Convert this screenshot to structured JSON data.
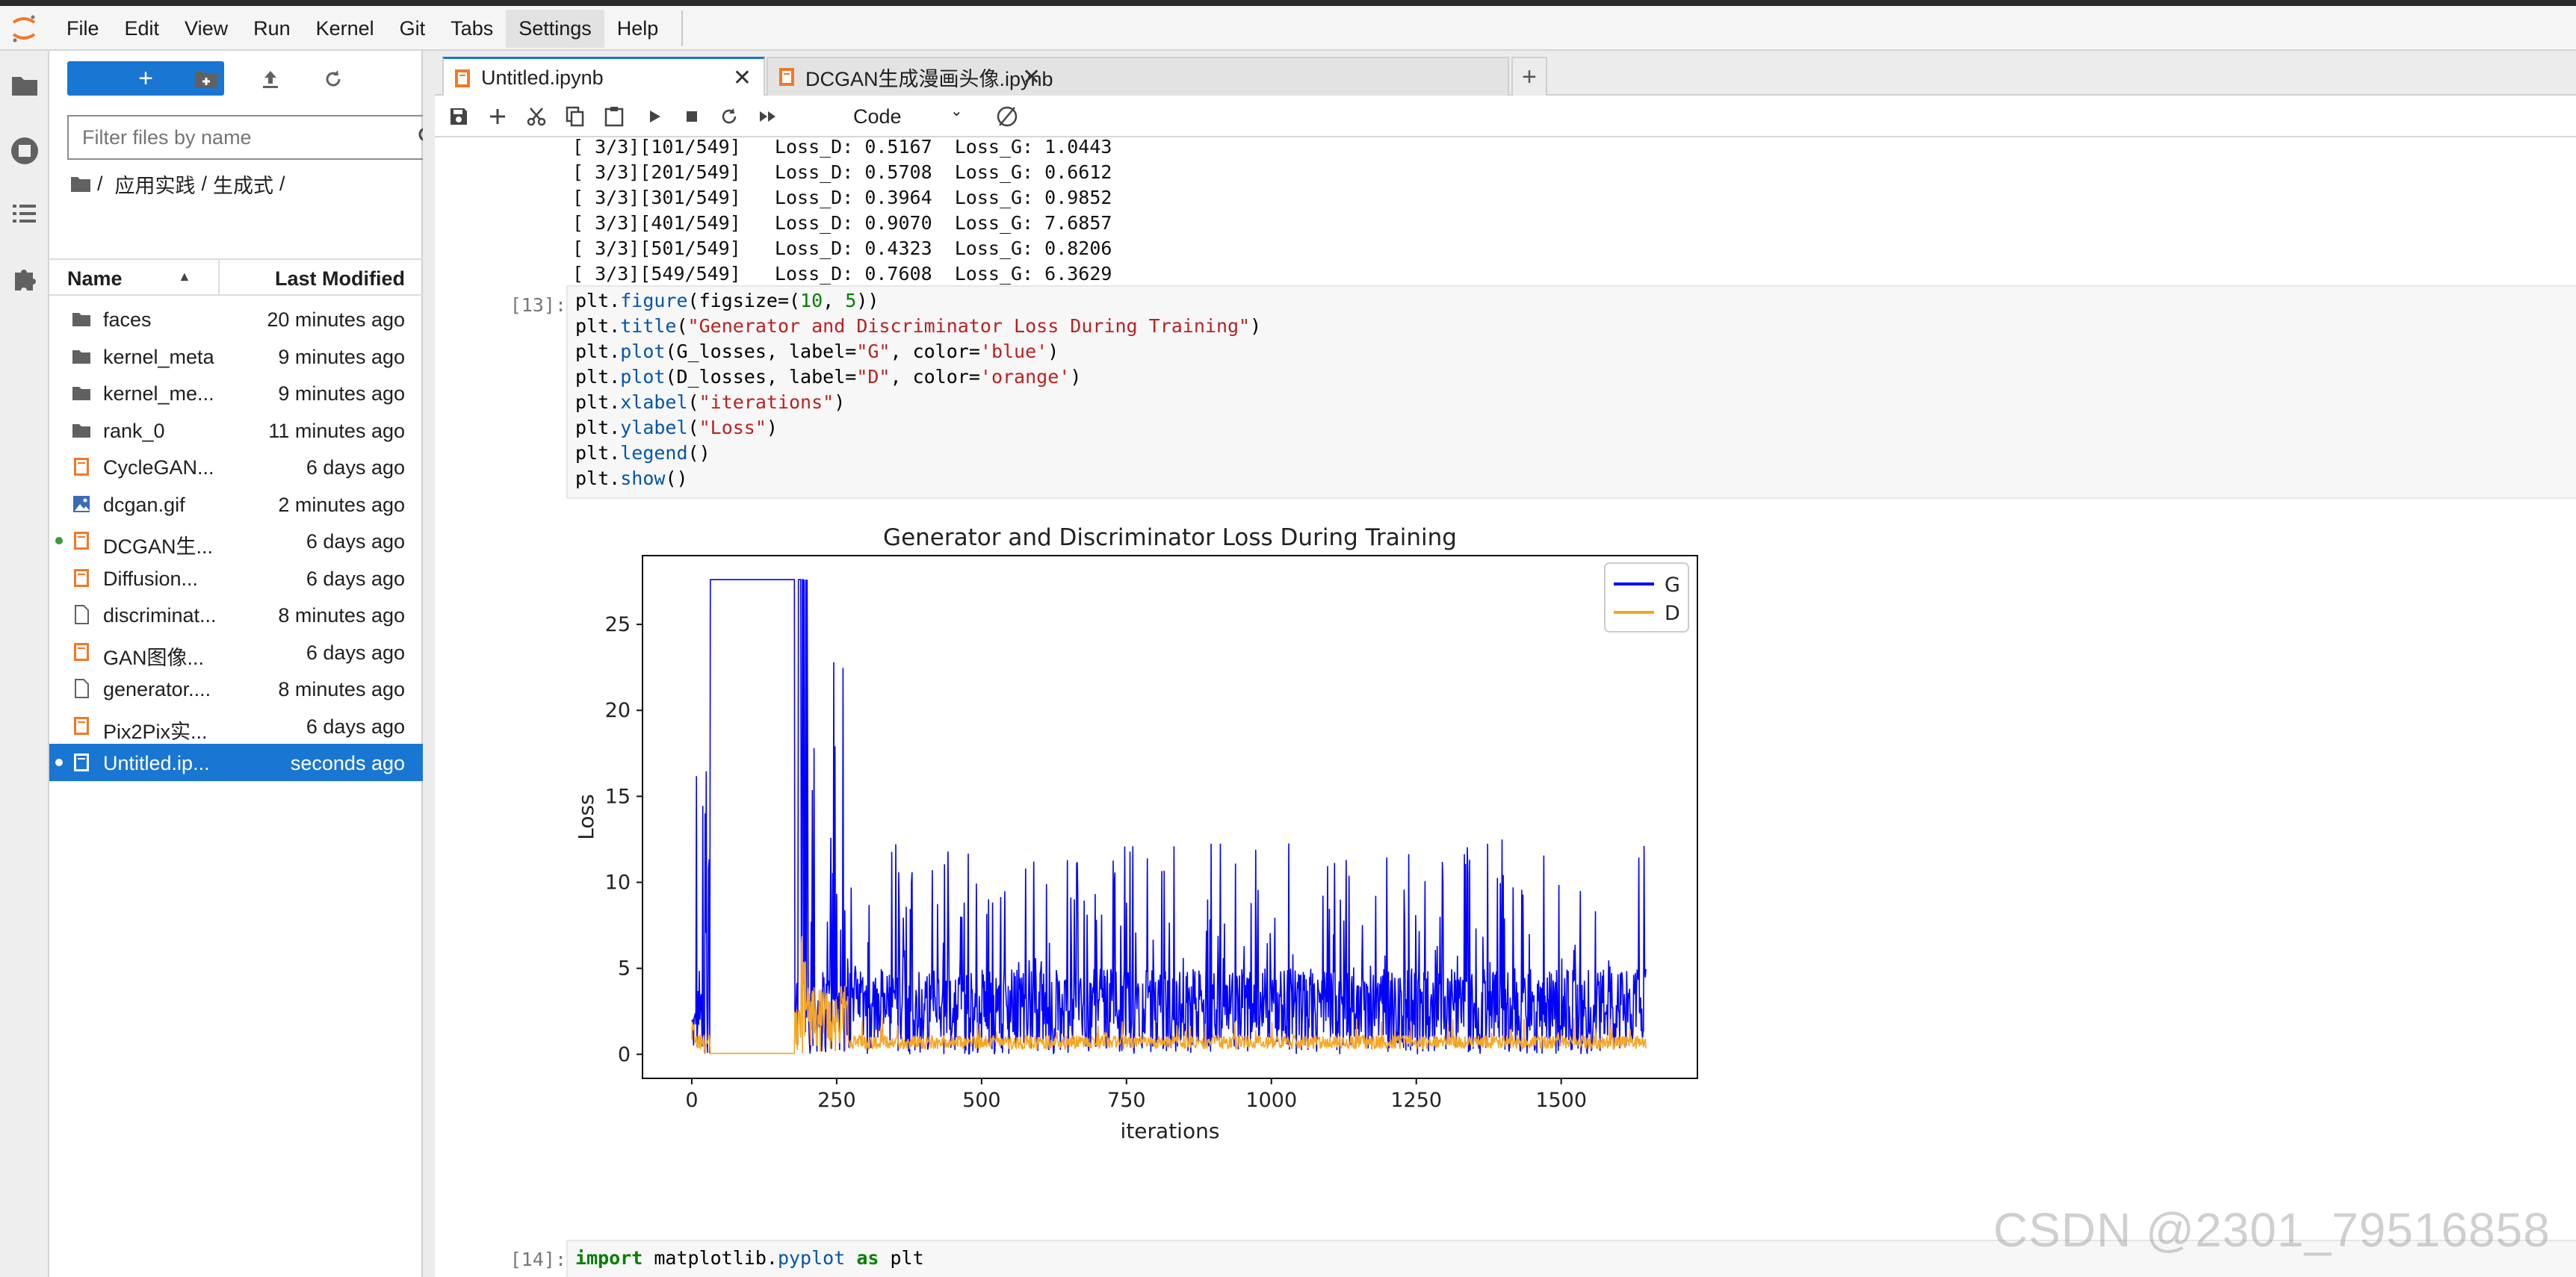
{
  "menu": [
    "File",
    "Edit",
    "View",
    "Run",
    "Kernel",
    "Git",
    "Tabs",
    "Settings",
    "Help"
  ],
  "menu_active": "Settings",
  "filebrowser": {
    "new_button": "+",
    "filter_placeholder": "Filter files by name",
    "breadcrumb": [
      "/",
      "应用实践",
      "/",
      "生成式",
      "/"
    ],
    "col_name": "Name",
    "col_modified": "Last Modified",
    "files": [
      {
        "name": "faces",
        "modified": "20 minutes ago",
        "kind": "folder",
        "running": false,
        "selected": false
      },
      {
        "name": "kernel_meta",
        "modified": "9 minutes ago",
        "kind": "folder",
        "running": false,
        "selected": false
      },
      {
        "name": "kernel_me...",
        "modified": "9 minutes ago",
        "kind": "folder",
        "running": false,
        "selected": false
      },
      {
        "name": "rank_0",
        "modified": "11 minutes ago",
        "kind": "folder",
        "running": false,
        "selected": false
      },
      {
        "name": "CycleGAN...",
        "modified": "6 days ago",
        "kind": "notebook",
        "running": false,
        "selected": false
      },
      {
        "name": "dcgan.gif",
        "modified": "2 minutes ago",
        "kind": "image",
        "running": false,
        "selected": false
      },
      {
        "name": "DCGAN生...",
        "modified": "6 days ago",
        "kind": "notebook",
        "running": true,
        "selected": false
      },
      {
        "name": "Diffusion...",
        "modified": "6 days ago",
        "kind": "notebook",
        "running": false,
        "selected": false
      },
      {
        "name": "discriminat...",
        "modified": "8 minutes ago",
        "kind": "file",
        "running": false,
        "selected": false
      },
      {
        "name": "GAN图像...",
        "modified": "6 days ago",
        "kind": "notebook",
        "running": false,
        "selected": false
      },
      {
        "name": "generator....",
        "modified": "8 minutes ago",
        "kind": "file",
        "running": false,
        "selected": false
      },
      {
        "name": "Pix2Pix实...",
        "modified": "6 days ago",
        "kind": "notebook",
        "running": false,
        "selected": false
      },
      {
        "name": "Untitled.ip...",
        "modified": "seconds ago",
        "kind": "notebook",
        "running": true,
        "selected": true
      }
    ]
  },
  "tabs": [
    {
      "label": "Untitled.ipynb",
      "active": true
    },
    {
      "label": "DCGAN生成漫画头像.ipynb",
      "active": false
    }
  ],
  "toolbar": {
    "cell_type": "Code"
  },
  "output_log": [
    "[ 3/3][101/549]   Loss_D: 0.5167  Loss_G: 1.0443",
    "[ 3/3][201/549]   Loss_D: 0.5708  Loss_G: 0.6612",
    "[ 3/3][301/549]   Loss_D: 0.3964  Loss_G: 0.9852",
    "[ 3/3][401/549]   Loss_D: 0.9070  Loss_G: 7.6857",
    "[ 3/3][501/549]   Loss_D: 0.4323  Loss_G: 0.8206",
    "[ 3/3][549/549]   Loss_D: 0.7608  Loss_G: 6.3629"
  ],
  "cell13": {
    "prompt": "[13]:",
    "lines": [
      "plt.figure(figsize=(10, 5))",
      "plt.title(\"Generator and Discriminator Loss During Training\")",
      "plt.plot(G_losses, label=\"G\", color='blue')",
      "plt.plot(D_losses, label=\"D\", color='orange')",
      "plt.xlabel(\"iterations\")",
      "plt.ylabel(\"Loss\")",
      "plt.legend()",
      "plt.show()"
    ]
  },
  "cell14": {
    "prompt": "[14]:",
    "line": "import matplotlib.pyplot as plt"
  },
  "chart_data": {
    "type": "line",
    "title": "Generator and Discriminator Loss During Training",
    "xlabel": "iterations",
    "ylabel": "Loss",
    "xlim": [
      -85,
      1735
    ],
    "ylim": [
      -1.4,
      29.0
    ],
    "xticks": [
      0,
      250,
      500,
      750,
      1000,
      1250,
      1500
    ],
    "yticks": [
      0,
      5,
      10,
      15,
      20,
      25
    ],
    "legend_position": "top-right",
    "series": [
      {
        "name": "G",
        "color": "#0000ff",
        "n_points": 1647
      },
      {
        "name": "D",
        "color": "#f5a623",
        "n_points": 1647
      }
    ]
  },
  "watermark": "CSDN @2301_79516858"
}
